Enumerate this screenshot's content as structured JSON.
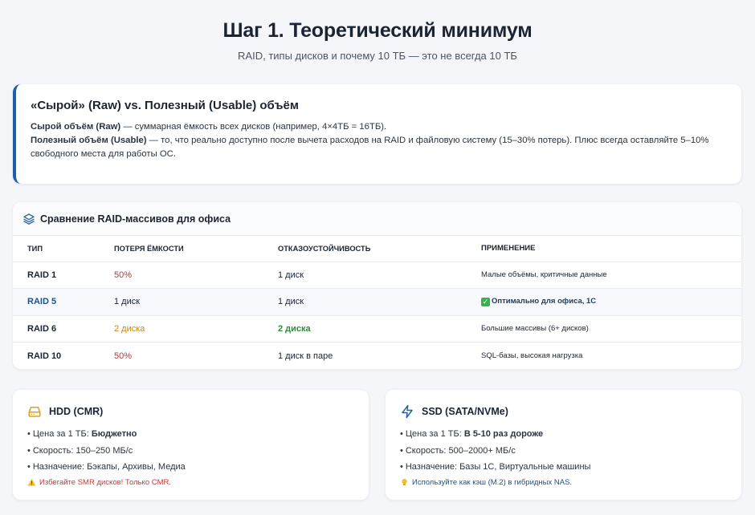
{
  "header": {
    "title": "Шаг 1. Теоретический минимум",
    "subtitle": "RAID, типы дисков и почему 10 ТБ — это не всегда 10 ТБ"
  },
  "info": {
    "title": "«Сырой» (Raw) vs. Полезный (Usable) объём",
    "raw_label": "Сырой объём (Raw)",
    "raw_text": " — суммарная ёмкость всех дисков (например, 4×4ТБ = 16ТБ).",
    "usable_label": "Полезный объём (Usable)",
    "usable_text": " — то, что реально доступно после вычета расходов на RAID и файловую систему (15–30% потерь). Плюс всегда оставляйте 5–10% свободного места для работы ОС.",
    "accent_color": "#1d5fa8"
  },
  "raid_table": {
    "icon": "layers-icon",
    "title": "Сравнение RAID-массивов для офиса",
    "columns": [
      "ТИП",
      "ПОТЕРЯ ЁМКОСТИ",
      "ОТКАЗОУСТОЙЧИВОСТЬ",
      "ПРИМЕНЕНИЕ"
    ],
    "rows": [
      {
        "type": "RAID 1",
        "loss": "50%",
        "fault": "1 диск",
        "usage": "Малые объёмы, критичные данные"
      },
      {
        "type": "RAID 5",
        "loss": "1 диск",
        "fault": "1 диск",
        "usage": "Оптимально для офиса, 1С"
      },
      {
        "type": "RAID 6",
        "loss": "2 диска",
        "fault": "2 диска",
        "usage": "Большие массивы (6+ дисков)"
      },
      {
        "type": "RAID 10",
        "loss": "50%",
        "fault": "1 диск в паре",
        "usage": "SQL-базы, высокая нагрузка"
      }
    ]
  },
  "hdd": {
    "icon": "hard-drive-icon",
    "title": "HDD (CMR)",
    "price_label": "Цена за 1 ТБ: ",
    "price_value": "Бюджетно",
    "speed": "Скорость: 150–250 МБ/с",
    "purpose": "Назначение: Бэкапы, Архивы, Медиа",
    "warning": "Избегайте SMR дисков! Только CMR.",
    "warning_icon": "warning-icon"
  },
  "ssd": {
    "icon": "lightning-icon",
    "title": "SSD (SATA/NVMe)",
    "price_label": "Цена за 1 ТБ: ",
    "price_value": "В 5-10 раз дороже",
    "speed": "Скорость: 500–2000+ МБ/с",
    "purpose": "Назначение: Базы 1С, Виртуальные машины",
    "tip": "Используйте как кэш (M.2) в гибридных NAS.",
    "tip_icon": "lightbulb-icon"
  },
  "bullet": "•",
  "colors": {
    "red": "#b83a3a",
    "orange": "#c7861d",
    "green": "#2d8a3c",
    "blue": "#1d4f8c",
    "hdd_icon": "#e0a019",
    "ssd_icon": "#2c5f9e"
  }
}
